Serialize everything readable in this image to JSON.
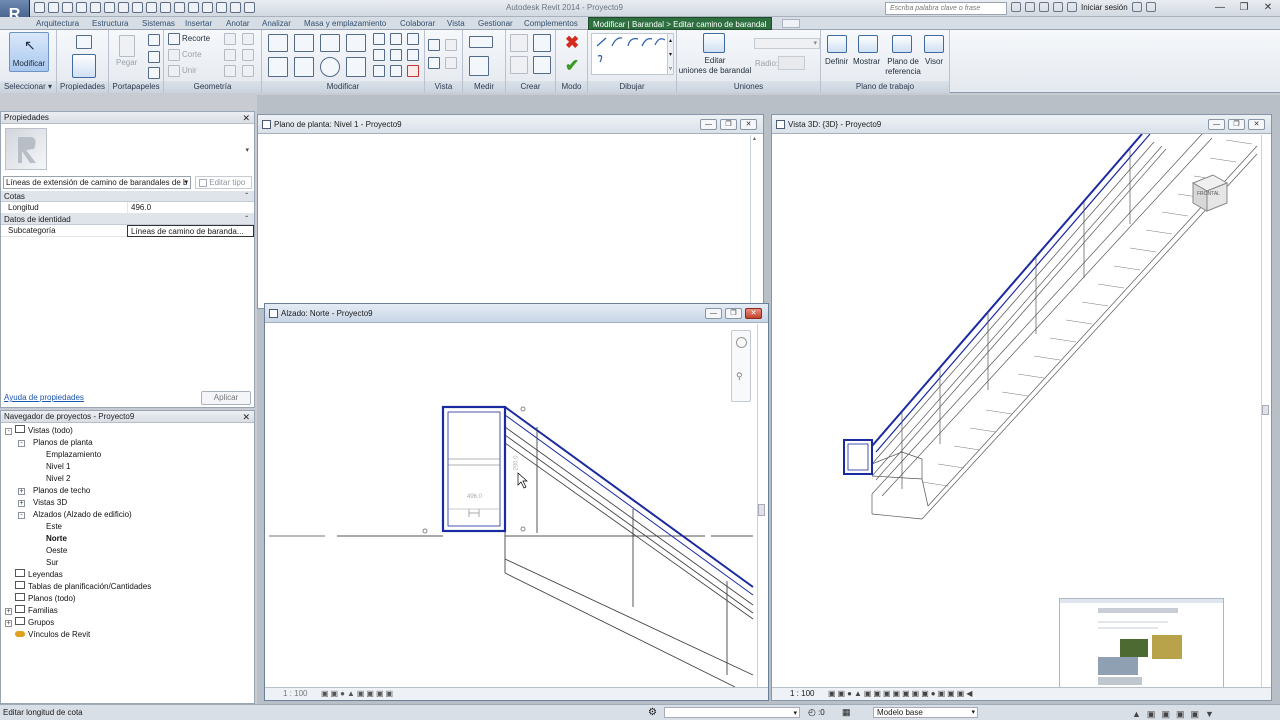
{
  "app": {
    "logo": "R",
    "title": "Autodesk Revit 2014  -  Proyecto9"
  },
  "search": {
    "placeholder": "Escriba palabra clave o frase"
  },
  "signin": "Iniciar sesión",
  "tabs": [
    "Arquitectura",
    "Estructura",
    "Sistemas",
    "Insertar",
    "Anotar",
    "Analizar",
    "Masa y emplazamiento",
    "Colaborar",
    "Vista",
    "Gestionar",
    "Complementos"
  ],
  "context_tab": "Modificar | Barandal > Editar camino de barandal",
  "ribbon": {
    "modificar": "Modificar",
    "pegar": "Pegar",
    "recorte": "Recorte",
    "corte": "Corte",
    "unir": "Unir",
    "editar_uniones": [
      "Editar",
      "uniones de barandal"
    ],
    "radio": "Radio:",
    "definir": "Definir",
    "mostrar": "Mostrar",
    "plano_ref": [
      "Plano de",
      "referencia"
    ],
    "visor": "Visor",
    "panels": {
      "seleccionar": "Seleccionar",
      "propiedades": "Propiedades",
      "portapapeles": "Portapapeles",
      "geometria": "Geometría",
      "modificar": "Modificar",
      "vista": "Vista",
      "medir": "Medir",
      "crear": "Crear",
      "modo": "Modo",
      "dibujar": "Dibujar",
      "uniones": "Uniones",
      "plano_trabajo": "Plano de trabajo"
    }
  },
  "properties": {
    "title": "Propiedades",
    "type_selector": "Líneas de extensión de camino de barandales de b",
    "edit_type": "Editar tipo",
    "groups": [
      {
        "name": "Cotas",
        "rows": [
          {
            "key": "Longitud",
            "value": "496.0"
          }
        ]
      },
      {
        "name": "Datos de identidad",
        "rows": [
          {
            "key": "Subcategoría",
            "value": "Líneas de camino de baranda..."
          }
        ]
      }
    ],
    "help_link": "Ayuda de propiedades",
    "apply": "Aplicar"
  },
  "browser": {
    "title": "Navegador de proyectos - Proyecto9",
    "items": [
      {
        "label": "Vistas (todo)"
      },
      {
        "label": "Planos de planta"
      },
      {
        "label": "Emplazamiento"
      },
      {
        "label": "Nivel 1"
      },
      {
        "label": "Nivel 2"
      },
      {
        "label": "Planos de techo"
      },
      {
        "label": "Vistas 3D"
      },
      {
        "label": "Alzados (Alzado de edificio)"
      },
      {
        "label": "Este"
      },
      {
        "label": "Norte"
      },
      {
        "label": "Oeste"
      },
      {
        "label": "Sur"
      },
      {
        "label": "Leyendas"
      },
      {
        "label": "Tablas de planificación/Cantidades"
      },
      {
        "label": "Planos (todo)"
      },
      {
        "label": "Familias"
      },
      {
        "label": "Grupos"
      },
      {
        "label": "Vínculos de Revit"
      }
    ]
  },
  "views": {
    "plan": "Plano de planta: Nivel 1 - Proyecto9",
    "elevation": "Alzado: Norte - Proyecto9",
    "three_d": "Vista 3D: {3D} - Proyecto9",
    "scale_3d": "1 : 100",
    "scale_elev": "1 : 100",
    "dim_text": "496.0",
    "dim_vertical": "200.0",
    "viewcube_face": "FRONTAL"
  },
  "status": {
    "message": "Editar longitud de cota",
    "coord": ":0",
    "model": "Modelo base"
  }
}
